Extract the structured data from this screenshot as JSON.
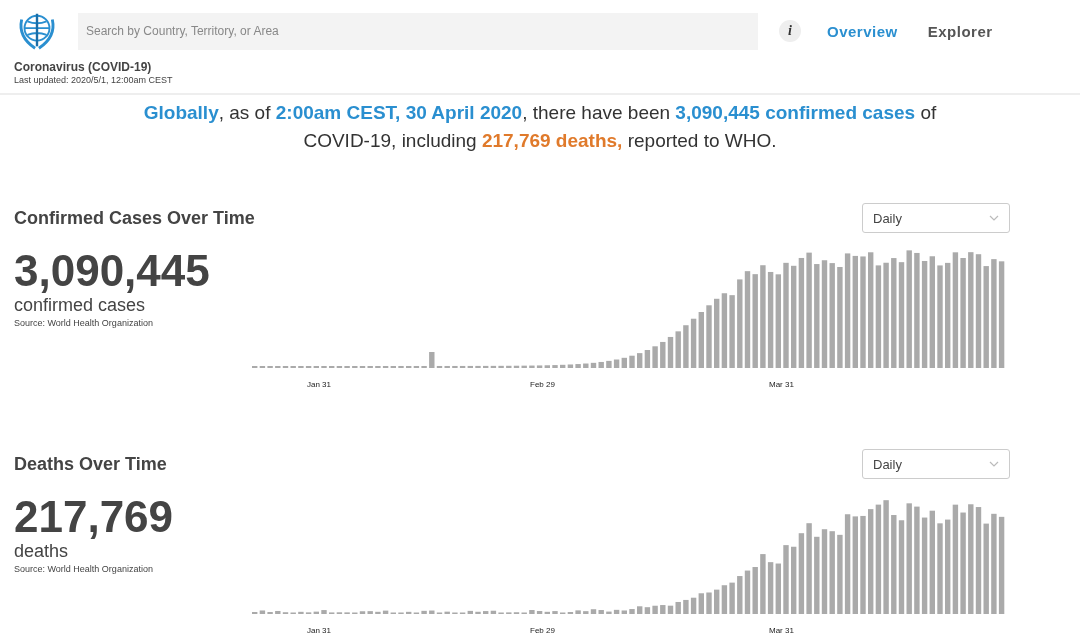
{
  "header": {
    "search": {
      "placeholder": "Search by Country, Territory, or Area"
    },
    "info": "i",
    "tabs": [
      {
        "label": "Overview",
        "selected": true
      },
      {
        "label": "Explorer",
        "selected": false
      }
    ],
    "title": "Coronavirus (COVID-19)",
    "updated": "Last updated: 2020/5/1, 12:00am CEST"
  },
  "headline": {
    "lines": [
      [
        {
          "kind": "highlight",
          "text": "Globally"
        },
        {
          "kind": "plain",
          "text": ", as of "
        },
        {
          "kind": "highlight",
          "text": "2:00am CEST, 30 April 2020"
        },
        {
          "kind": "plain",
          "text": ", there have been "
        },
        {
          "kind": "highlight",
          "text": "3,090,445 confirmed cases"
        },
        {
          "kind": "plain",
          "text": " of"
        }
      ],
      [
        {
          "kind": "plain",
          "text": "COVID-19, including "
        },
        {
          "kind": "alert",
          "text": "217,769 deaths,"
        },
        {
          "kind": "plain",
          "text": " reported to WHO."
        }
      ]
    ]
  },
  "sections": [
    {
      "kind": "cases",
      "title": "Confirmed Cases Over Time",
      "total": "3,090,445",
      "unit": "confirmed cases",
      "source": "Source: World Health Organization",
      "dropdown": "Daily",
      "axis_labels": [
        "Jan 31",
        "Feb 29",
        "Mar 31"
      ]
    },
    {
      "kind": "deaths",
      "title": "Deaths Over Time",
      "total": "217,769",
      "unit": "deaths",
      "source": "Source: World Health Organization",
      "dropdown": "Daily",
      "axis_labels": [
        "Jan 31",
        "Feb 29",
        "Mar 31"
      ]
    }
  ]
}
